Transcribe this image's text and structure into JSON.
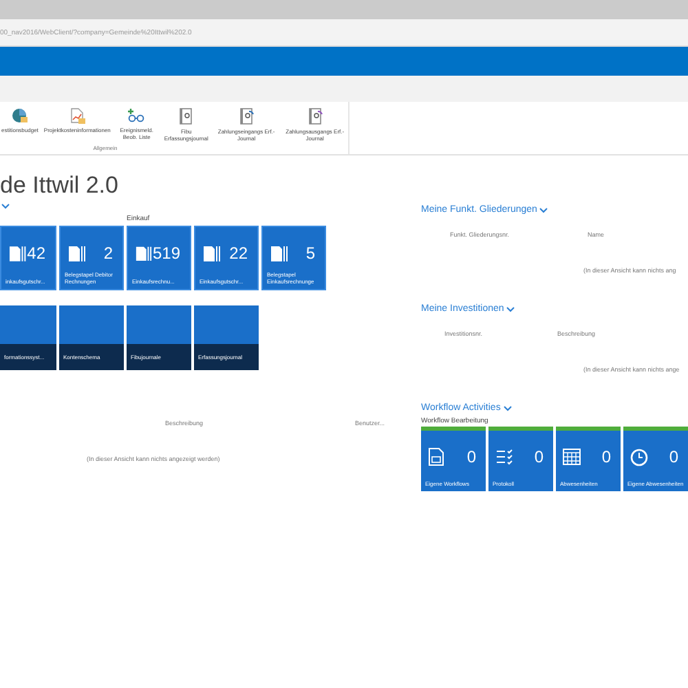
{
  "address_bar": {
    "url": "00_nav2016/WebClient/?company=Gemeinde%20Ittwil%202.0"
  },
  "ribbon": {
    "group_label": "Allgemein",
    "items": [
      {
        "label": "estitionsbudget"
      },
      {
        "label": "Projektkosteninformationen"
      },
      {
        "label": "Ereignismeld. Beob. Liste"
      },
      {
        "label": "Fibu Erfassungsjournal"
      },
      {
        "label": "Zahlungseingangs Erf.-Journal"
      },
      {
        "label": "Zahlungsausgangs Erf.-Journal"
      }
    ]
  },
  "page_title": "de Ittwil 2.0",
  "left": {
    "tile_group_label": "Einkauf",
    "count_tiles": [
      {
        "count": "42",
        "label": "inkaufsgutschr..."
      },
      {
        "count": "2",
        "label": "Belegstapel Debitor Rechnungen"
      },
      {
        "count": "519",
        "label": "Einkaufsrechnu..."
      },
      {
        "count": "22",
        "label": "Einkaufsgutschr..."
      },
      {
        "count": "5",
        "label": "Belegstapel Einkaufsrechnunge"
      }
    ],
    "link_tiles": [
      {
        "label": "formationssyst..."
      },
      {
        "label": "Kontenschema"
      },
      {
        "label": "Fibujournale"
      },
      {
        "label": "Erfassungsjournal"
      }
    ],
    "list": {
      "columns": [
        "Beschreibung",
        "Benutzer..."
      ],
      "empty_message": "(In dieser Ansicht kann nichts angezeigt werden)"
    }
  },
  "right": {
    "sections": [
      {
        "title": "Meine Funkt. Gliederungen",
        "columns": [
          "Funkt. Gliederungsnr.",
          "Name"
        ],
        "empty_message": "(In dieser Ansicht kann nichts ang"
      },
      {
        "title": "Meine Investitionen",
        "columns": [
          "Investitionsnr.",
          "Beschreibung"
        ],
        "empty_message": "(In dieser Ansicht kann nichts ange"
      }
    ],
    "workflow": {
      "title": "Workflow Activities",
      "subtitle": "Workflow Bearbeitung",
      "tiles": [
        {
          "count": "0",
          "label": "Eigene Workflows"
        },
        {
          "count": "0",
          "label": "Protokoll"
        },
        {
          "count": "0",
          "label": "Abwesenheiten"
        },
        {
          "count": "0",
          "label": "Eigene Abwesenheiten"
        }
      ]
    }
  }
}
